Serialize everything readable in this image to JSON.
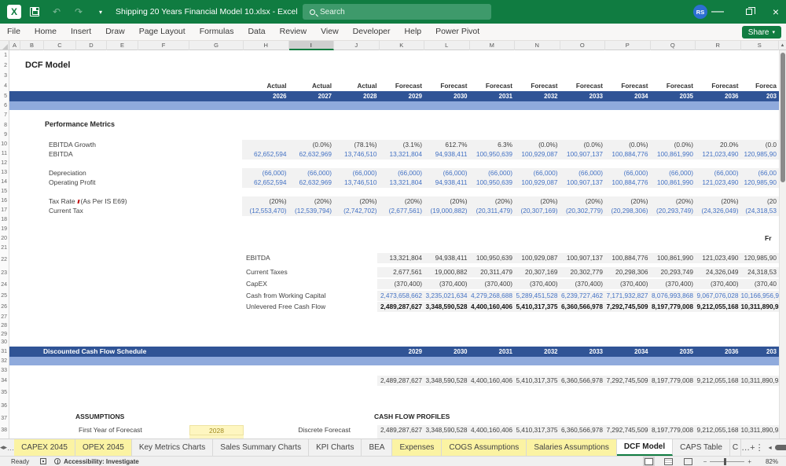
{
  "title_bar": {
    "title": "Shipping 20 Years Financial Model 10.xlsx - Excel",
    "search_placeholder": "Search",
    "avatar_initials": "RS"
  },
  "ribbon": {
    "tabs": [
      "File",
      "Home",
      "Insert",
      "Draw",
      "Page Layout",
      "Formulas",
      "Data",
      "Review",
      "View",
      "Developer",
      "Help",
      "Power Pivot"
    ],
    "share_label": "Share"
  },
  "grid": {
    "column_headers": [
      "A",
      "B",
      "C",
      "D",
      "E",
      "F",
      "G",
      "H",
      "I",
      "J",
      "K",
      "L",
      "M",
      "N",
      "O",
      "P",
      "Q",
      "R",
      "S"
    ],
    "selected_column": "I",
    "row_numbers": [
      1,
      2,
      3,
      4,
      5,
      6,
      7,
      8,
      9,
      10,
      11,
      12,
      13,
      14,
      15,
      16,
      17,
      18,
      19,
      20,
      21,
      22,
      23,
      24,
      25,
      26,
      27,
      28,
      29,
      30,
      31,
      32,
      33,
      34,
      35,
      36,
      37,
      38
    ]
  },
  "sheet": {
    "title": "DCF Model",
    "header": {
      "period_labels": [
        "Actual",
        "Actual",
        "Actual",
        "Forecast",
        "Forecast",
        "Forecast",
        "Forecast",
        "Forecast",
        "Forecast",
        "Forecast",
        "Forecast",
        "Foreca"
      ],
      "years": [
        "2026",
        "2027",
        "2028",
        "2029",
        "2030",
        "2031",
        "2032",
        "2033",
        "2034",
        "2035",
        "2036",
        "203"
      ]
    },
    "performance_metrics": {
      "section_title": "Performance Metrics",
      "rows": [
        {
          "row": 10,
          "label": "EBITDA Growth",
          "kind": "pct",
          "values": [
            "",
            "(0.0%)",
            "(78.1%)",
            "(3.1%)",
            "612.7%",
            "6.3%",
            "(0.0%)",
            "(0.0%)",
            "(0.0%)",
            "(0.0%)",
            "20.0%",
            "(0.0"
          ]
        },
        {
          "row": 11,
          "label": "EBITDA",
          "kind": "blue",
          "values": [
            "62,652,594",
            "62,632,969",
            "13,746,510",
            "13,321,804",
            "94,938,411",
            "100,950,639",
            "100,929,087",
            "100,907,137",
            "100,884,776",
            "100,861,990",
            "121,023,490",
            "120,985,90"
          ]
        },
        {
          "row": 13,
          "label": "Depreciation",
          "kind": "blue",
          "values": [
            "(66,000)",
            "(66,000)",
            "(66,000)",
            "(66,000)",
            "(66,000)",
            "(66,000)",
            "(66,000)",
            "(66,000)",
            "(66,000)",
            "(66,000)",
            "(66,000)",
            "(66,00"
          ]
        },
        {
          "row": 14,
          "label": "Operating Profit",
          "kind": "blue",
          "values": [
            "62,652,594",
            "62,632,969",
            "13,746,510",
            "13,321,804",
            "94,938,411",
            "100,950,639",
            "100,929,087",
            "100,907,137",
            "100,884,776",
            "100,861,990",
            "121,023,490",
            "120,985,90"
          ]
        },
        {
          "row": 16,
          "label": "Tax Rate",
          "note": "(As Per IS E69)",
          "flag": true,
          "kind": "pct",
          "values": [
            "(20%)",
            "(20%)",
            "(20%)",
            "(20%)",
            "(20%)",
            "(20%)",
            "(20%)",
            "(20%)",
            "(20%)",
            "(20%)",
            "(20%)",
            "(20"
          ]
        },
        {
          "row": 17,
          "label": "Current Tax",
          "kind": "blue",
          "values": [
            "(12,553,470)",
            "(12,539,794)",
            "(2,742,702)",
            "(2,677,561)",
            "(19,000,882)",
            "(20,311,479)",
            "(20,307,169)",
            "(20,302,779)",
            "(20,298,306)",
            "(20,293,749)",
            "(24,326,049)",
            "(24,318,53"
          ]
        }
      ]
    },
    "fcf_fragment": "Fr",
    "free_cash_flow": {
      "rows": [
        {
          "row": 22,
          "label": "EBITDA",
          "kind": "black",
          "values": [
            "13,321,804",
            "94,938,411",
            "100,950,639",
            "100,929,087",
            "100,907,137",
            "100,884,776",
            "100,861,990",
            "121,023,490",
            "120,985,90"
          ]
        },
        {
          "row": 23,
          "label": "Current Taxes",
          "kind": "black",
          "values": [
            "2,677,561",
            "19,000,882",
            "20,311,479",
            "20,307,169",
            "20,302,779",
            "20,298,306",
            "20,293,749",
            "24,326,049",
            "24,318,53"
          ]
        },
        {
          "row": 24,
          "label": "CapEX",
          "kind": "black",
          "values": [
            "(370,400)",
            "(370,400)",
            "(370,400)",
            "(370,400)",
            "(370,400)",
            "(370,400)",
            "(370,400)",
            "(370,400)",
            "(370,40"
          ]
        },
        {
          "row": 25,
          "label": "Cash from Working Capital",
          "kind": "blue",
          "values": [
            "2,473,658,662",
            "3,235,021,634",
            "4,279,268,688",
            "5,289,451,528",
            "6,239,727,462",
            "7,171,932,827",
            "8,076,993,868",
            "9,067,076,028",
            "10,166,956,90"
          ]
        },
        {
          "row": 26,
          "label": "Unlevered Free Cash Flow",
          "kind": "bold",
          "values": [
            "2,489,287,627",
            "3,348,590,528",
            "4,400,160,406",
            "5,410,317,375",
            "6,360,566,978",
            "7,292,745,509",
            "8,197,779,008",
            "9,212,055,168",
            "10,311,890,93"
          ]
        }
      ]
    },
    "dcf_schedule": {
      "title": "Discounted Cash Flow Schedule",
      "years": [
        "2029",
        "2030",
        "2031",
        "2032",
        "2033",
        "2034",
        "2035",
        "2036",
        "203"
      ],
      "values": [
        "2,489,287,627",
        "3,348,590,528",
        "4,400,160,406",
        "5,410,317,375",
        "6,360,566,978",
        "7,292,745,509",
        "8,197,779,008",
        "9,212,055,168",
        "10,311,890,93"
      ]
    },
    "assumptions": {
      "section_title": "ASSUMPTIONS",
      "first_year_label": "First Year of Forecast",
      "first_year_value": "2028",
      "forecast_type": "Discrete Forecast"
    },
    "cash_flow_profiles": {
      "section_title": "CASH FLOW PROFILES",
      "values": [
        "2,489,287,627",
        "3,348,590,528",
        "4,400,160,406",
        "5,410,317,375",
        "6,360,566,978",
        "7,292,745,509",
        "8,197,779,008",
        "9,212,055,168",
        "10,311,890,93"
      ]
    }
  },
  "sheet_tabs": {
    "items": [
      {
        "label": "CAPEX 2045",
        "kind": "yellow"
      },
      {
        "label": "OPEX 2045",
        "kind": "yellow"
      },
      {
        "label": "Key Metrics Charts",
        "kind": "plain"
      },
      {
        "label": "Sales Summary Charts",
        "kind": "plain"
      },
      {
        "label": "KPI Charts",
        "kind": "plain"
      },
      {
        "label": "BEA",
        "kind": "plain"
      },
      {
        "label": "Expenses",
        "kind": "yellow"
      },
      {
        "label": "COGS Assumptions",
        "kind": "yellow"
      },
      {
        "label": "Salaries Assumptions",
        "kind": "yellow"
      },
      {
        "label": "DCF Model",
        "kind": "active"
      },
      {
        "label": "CAPS Table",
        "kind": "plain"
      },
      {
        "label": "C",
        "kind": "partial"
      }
    ]
  },
  "status_bar": {
    "ready": "Ready",
    "accessibility": "Accessibility: Investigate",
    "zoom": "82%"
  }
}
